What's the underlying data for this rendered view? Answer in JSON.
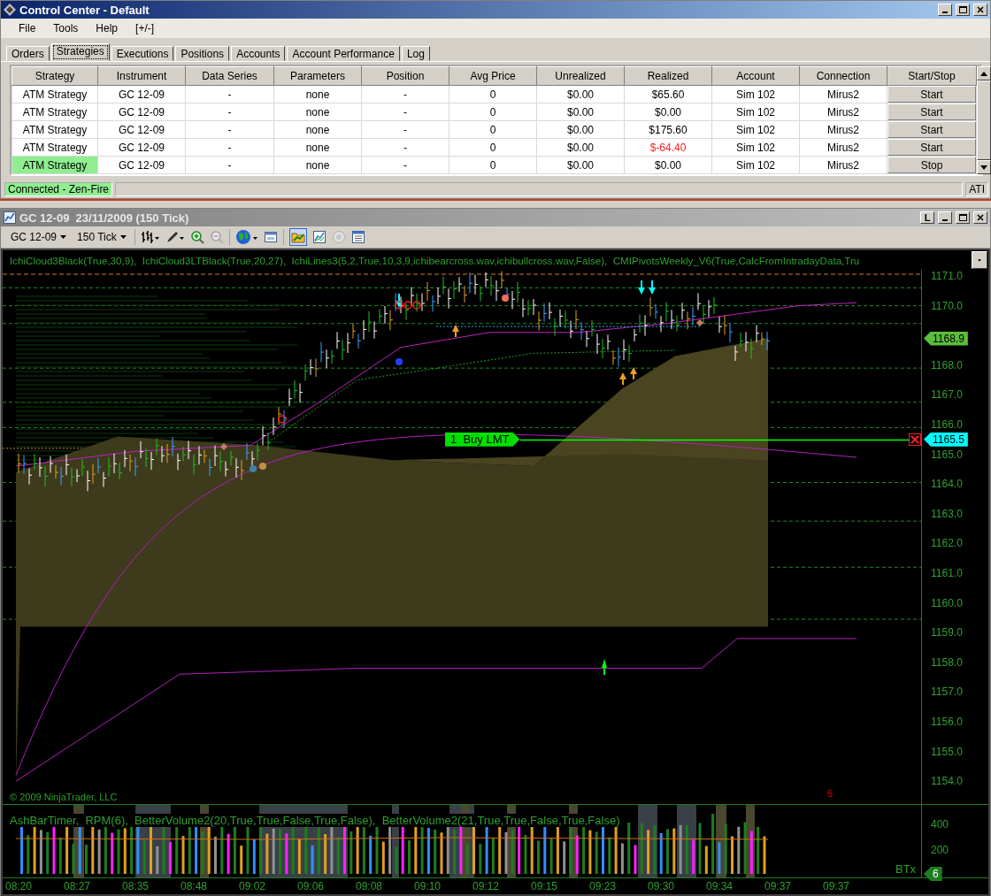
{
  "control_center": {
    "title": "Control Center - Default",
    "menu": [
      "File",
      "Tools",
      "Help",
      "[+/-]"
    ],
    "tabs": [
      {
        "label": "Orders",
        "selected": false
      },
      {
        "label": "Strategies",
        "selected": true
      },
      {
        "label": "Executions",
        "selected": false
      },
      {
        "label": "Positions",
        "selected": false
      },
      {
        "label": "Accounts",
        "selected": false
      },
      {
        "label": "Account Performance",
        "selected": false
      },
      {
        "label": "Log",
        "selected": false
      }
    ],
    "table": {
      "columns": [
        "Strategy",
        "Instrument",
        "Data Series",
        "Parameters",
        "Position",
        "Avg Price",
        "Unrealized",
        "Realized",
        "Account",
        "Connection",
        "Start/Stop"
      ],
      "rows": [
        {
          "cells": [
            "ATM Strategy",
            "GC 12-09",
            "-",
            "none",
            "-",
            "0",
            "$0.00",
            "$65.60",
            "Sim 102",
            "Mirus2"
          ],
          "button": "Start",
          "running": false,
          "loss": false
        },
        {
          "cells": [
            "ATM Strategy",
            "GC 12-09",
            "-",
            "none",
            "-",
            "0",
            "$0.00",
            "$0.00",
            "Sim 102",
            "Mirus2"
          ],
          "button": "Start",
          "running": false,
          "loss": false
        },
        {
          "cells": [
            "ATM Strategy",
            "GC 12-09",
            "-",
            "none",
            "-",
            "0",
            "$0.00",
            "$175.60",
            "Sim 102",
            "Mirus2"
          ],
          "button": "Start",
          "running": false,
          "loss": false
        },
        {
          "cells": [
            "ATM Strategy",
            "GC 12-09",
            "-",
            "none",
            "-",
            "0",
            "$0.00",
            "$-64.40",
            "Sim 102",
            "Mirus2"
          ],
          "button": "Start",
          "running": false,
          "loss": true
        },
        {
          "cells": [
            "ATM Strategy",
            "GC 12-09",
            "-",
            "none",
            "-",
            "0",
            "$0.00",
            "$0.00",
            "Sim 102",
            "Mirus2"
          ],
          "button": "Stop",
          "running": true,
          "loss": false
        }
      ]
    },
    "status_bar": {
      "connection": "Connected - Zen-Fire",
      "right": "ATI"
    }
  },
  "chart_window": {
    "title": "GC 12-09  23/11/2009 (150 Tick)",
    "title_button": "L",
    "toolbar": {
      "instrument": "GC 12-09",
      "period": "150 Tick"
    },
    "indicators": "IchiCloud3Black(True,30,9),  IchiCloud3LTBlack(True,20,27),  IchiLines3(5,2,True,10,3,9,ichibearcross.wav,ichibullcross.wav,False),  CMIPivotsWeekly_V6(True,CalcFromIntradayData,Tru",
    "price_axis": [
      "1171.0",
      "1170.0",
      "1168.0",
      "1167.0",
      "1166.0",
      "1165.0",
      "1164.0",
      "1163.0",
      "1162.0",
      "1161.0",
      "1160.0",
      "1159.0",
      "1158.0",
      "1157.0",
      "1156.0",
      "1155.0",
      "1154.0"
    ],
    "last_price": "1168.9",
    "order": {
      "quantity": "1",
      "label": "Buy LMT",
      "price": "1165.5"
    },
    "copyright": "© 2009 NinjaTrader, LLC",
    "bar_count": "5",
    "lower_panel": {
      "indicators": "AshBarTimer,  RPM(6),  BetterVolume2(20,True,True,False,True,False),  BetterVolume2(21,True,True,False,True,False)",
      "axis": [
        "400",
        "200"
      ],
      "label": "BTx",
      "flag": "6"
    },
    "time_axis": [
      "08:20",
      "08:27",
      "08:35",
      "08:48",
      "09:02",
      "09:06",
      "09:08",
      "09:10",
      "09:12",
      "09:15",
      "09:23",
      "09:30",
      "09:34",
      "09:37",
      "09:37"
    ]
  }
}
